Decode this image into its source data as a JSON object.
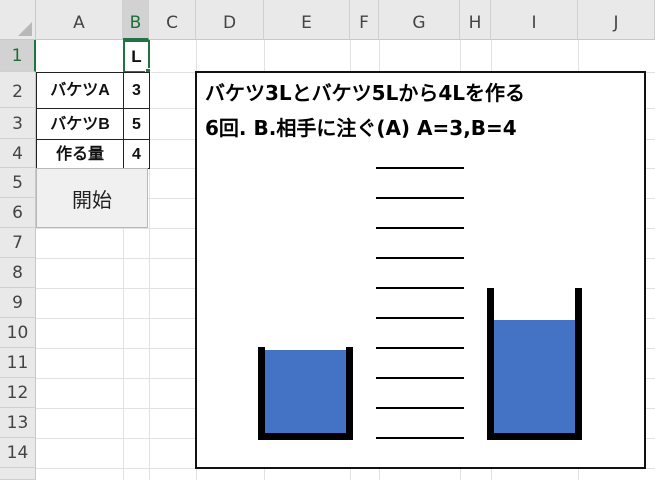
{
  "columns": [
    "A",
    "B",
    "C",
    "D",
    "E",
    "F",
    "G",
    "H",
    "I",
    "J"
  ],
  "rows": [
    "1",
    "2",
    "3",
    "4",
    "5",
    "6",
    "7",
    "8",
    "9",
    "10",
    "11",
    "12",
    "13",
    "14"
  ],
  "active_cell": {
    "column": "B",
    "row": "1"
  },
  "cells": {
    "B1": "L",
    "A2": "バケツA",
    "B2": "3",
    "A3": "バケツB",
    "B3": "5",
    "A4": "作る量",
    "B4": "4"
  },
  "start_button": {
    "label": "開始"
  },
  "panel": {
    "title": "バケツ3Lとバケツ5Lから4Lを作る",
    "status": "6回.  B.相手に注ぐ(A)  A=3,B=4"
  },
  "buckets": {
    "a": {
      "capacity_l": 3,
      "amount_l": 3
    },
    "b": {
      "capacity_l": 5,
      "amount_l": 4
    }
  },
  "scale_ticks": 10,
  "colors": {
    "water": "#4472c4",
    "bucket_wall": "#000000",
    "accent": "#217346"
  }
}
